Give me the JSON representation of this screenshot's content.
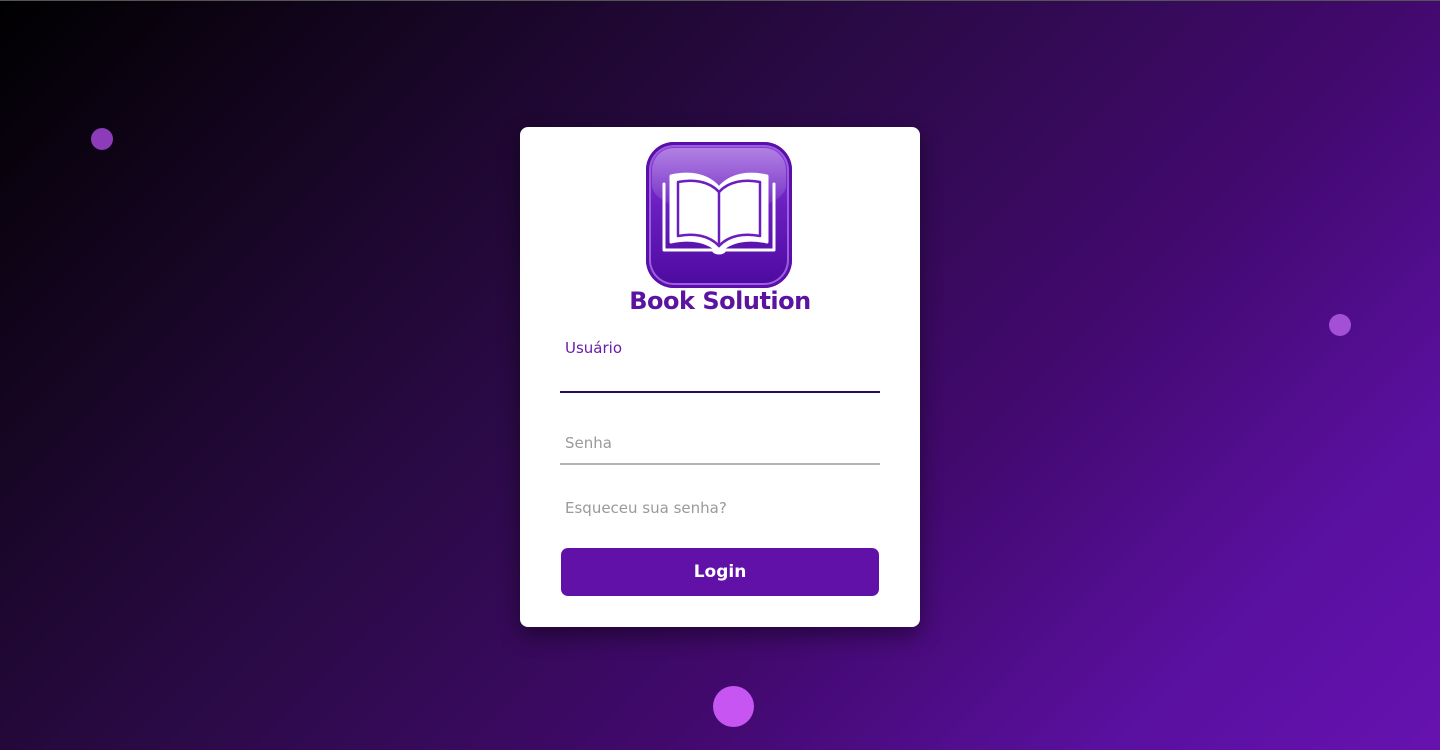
{
  "brand": {
    "name": "Book Solution",
    "icon": "open-book-icon"
  },
  "form": {
    "username_label": "Usuário",
    "username_value": "",
    "password_label": "Senha",
    "password_value": "",
    "forgot_link": "Esqueceu sua senha?",
    "login_label": "Login"
  },
  "colors": {
    "accent": "#6211a8",
    "brand_text": "#5c14a0",
    "background_start": "#000000",
    "background_end": "#6612b0",
    "card": "#ffffff"
  }
}
